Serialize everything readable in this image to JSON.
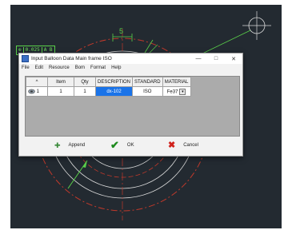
{
  "window": {
    "title": "Input Balloon Data Main frame ISO",
    "minimize_glyph": "—",
    "maximize_glyph": "□",
    "close_glyph": "✕"
  },
  "menu": [
    {
      "label": "File"
    },
    {
      "label": "Edit"
    },
    {
      "label": "Resource"
    },
    {
      "label": "Bom"
    },
    {
      "label": "Format"
    },
    {
      "label": "Help"
    }
  ],
  "table": {
    "headers": [
      "^",
      "Item",
      "Qty",
      "DESCRIPTION",
      "STANDARD",
      "MATERIAL"
    ],
    "rows": [
      {
        "index": "1",
        "item": "1",
        "qty": "1",
        "description": "dx-102",
        "standard": "ISO",
        "material": "Fe37"
      }
    ]
  },
  "buttons": {
    "append": "Append",
    "ok": "OK",
    "cancel": "Cancel"
  },
  "drawing": {
    "tolerance_frame": [
      "⊕",
      "0.025",
      "A B"
    ],
    "dimension_text": "5"
  },
  "colors": {
    "background": "#232a31",
    "construction_red": "#c0392b",
    "geometry_white": "#d9d9d9",
    "dimension_green": "#5ad04a",
    "selection_blue": "#1a73e8"
  },
  "icons": {
    "app": "app-icon",
    "append": "plus-icon",
    "ok": "check-icon",
    "cancel": "x-icon",
    "row": "part-icon"
  }
}
